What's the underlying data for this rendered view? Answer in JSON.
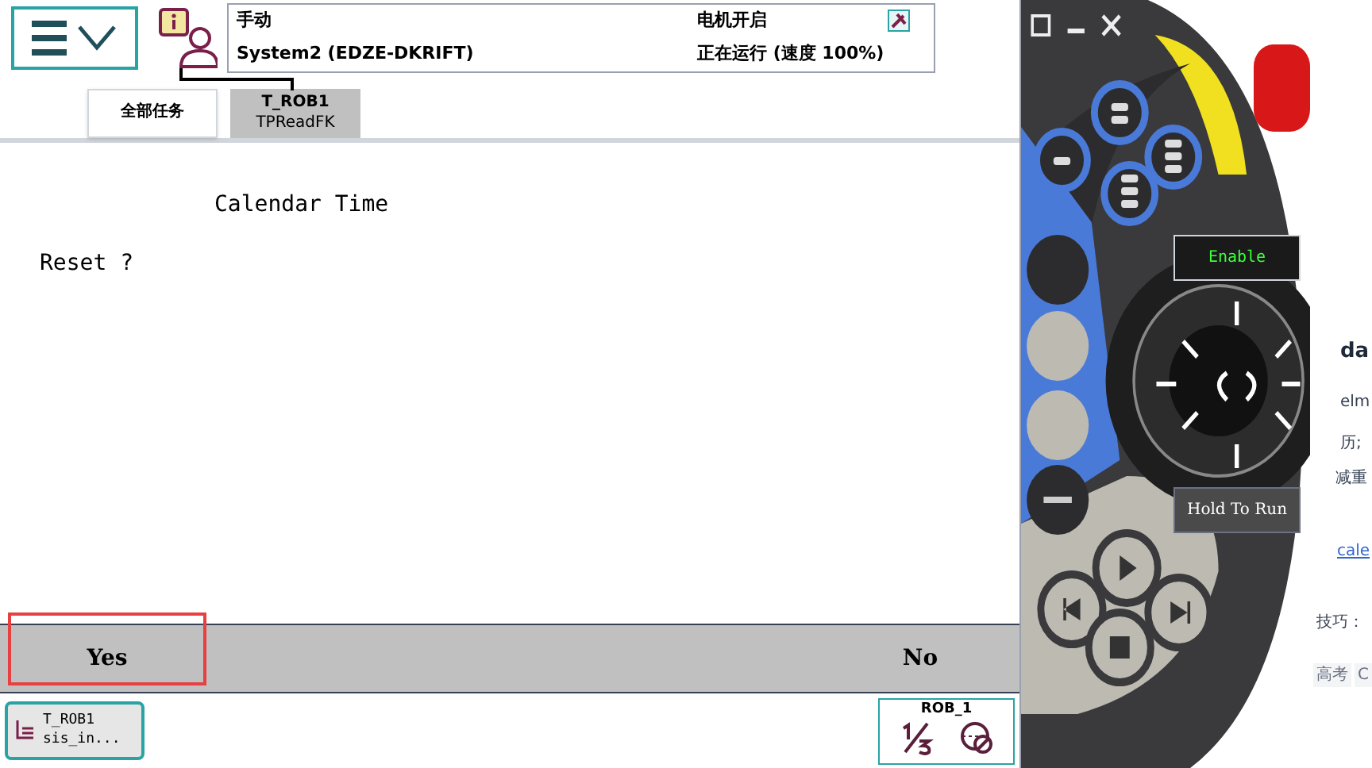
{
  "header": {
    "status": [
      "手动",
      "System2 (EDZE-DKRIFT)",
      "电机开启",
      "正在运行 (速度 100%)"
    ]
  },
  "tabs": [
    {
      "label": "全部任务",
      "selected": false
    },
    {
      "label": "T_ROB1",
      "sublabel": "TPReadFK",
      "selected": true
    }
  ],
  "message": {
    "title": "Calendar Time",
    "prompt": "Reset ?"
  },
  "buttons": [
    {
      "label": "Yes",
      "highlighted": true
    },
    {
      "label": "No",
      "highlighted": false
    }
  ],
  "taskbar": {
    "task": [
      "T_ROB1",
      "sis_in..."
    ],
    "quickset": {
      "unit": "ROB_1"
    }
  },
  "pendant": {
    "enable": "Enable",
    "hold": "Hold To Run"
  },
  "background_page": {
    "fragments": [
      "da",
      "elm",
      "历;",
      "减重",
      "cale",
      "技巧：",
      "高考",
      "C"
    ]
  }
}
